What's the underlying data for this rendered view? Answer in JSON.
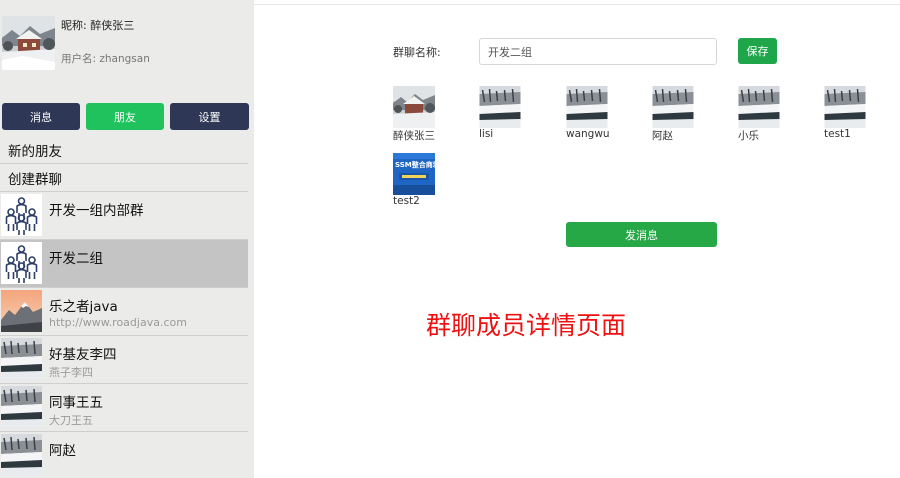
{
  "profile": {
    "nickname_label": "昵称: 醉侠张三",
    "username_label": "用户名: zhangsan",
    "avatar_icon": "winter-house-photo"
  },
  "nav": {
    "messages_label": "消息",
    "friends_label": "朋友",
    "settings_label": "设置",
    "active": "friends",
    "colors": {
      "dark": "#2e3756",
      "active": "#1fc25d"
    }
  },
  "menu": {
    "new_friends": "新的朋友",
    "create_group": "创建群聊"
  },
  "chats": [
    {
      "name": "开发一组内部群",
      "sub": "",
      "icon": "group-people-icon"
    },
    {
      "name": "开发二组",
      "sub": "",
      "icon": "group-people-icon",
      "active": true
    },
    {
      "name": "乐之者java",
      "sub": "http://www.roadjava.com",
      "icon": "mountain-sunset-photo"
    },
    {
      "name": "好基友李四",
      "sub": "燕子李四",
      "icon": "winter-river-photo"
    },
    {
      "name": "同事王五",
      "sub": "大刀王五",
      "icon": "winter-river-photo"
    },
    {
      "name": "阿赵",
      "sub": "",
      "icon": "winter-river-photo"
    }
  ],
  "group_detail": {
    "name_label": "群聊名称:",
    "name_value": "开发二组",
    "save_label": "保存",
    "send_label": "发消息",
    "members": [
      {
        "name": "醉侠张三",
        "icon": "winter-house-photo"
      },
      {
        "name": "lisi",
        "icon": "winter-river-photo"
      },
      {
        "name": "wangwu",
        "icon": "winter-river-photo"
      },
      {
        "name": "阿赵",
        "icon": "winter-river-photo"
      },
      {
        "name": "小乐",
        "icon": "winter-river-photo"
      },
      {
        "name": "test1",
        "icon": "winter-river-photo"
      },
      {
        "name": "test2",
        "icon": "ssm-banner-image",
        "image_text": "SSM整合商城"
      }
    ]
  },
  "caption": "群聊成员详情页面",
  "colors": {
    "save": "#1fa64a",
    "send": "#27a846",
    "caption": "#ee1111"
  }
}
